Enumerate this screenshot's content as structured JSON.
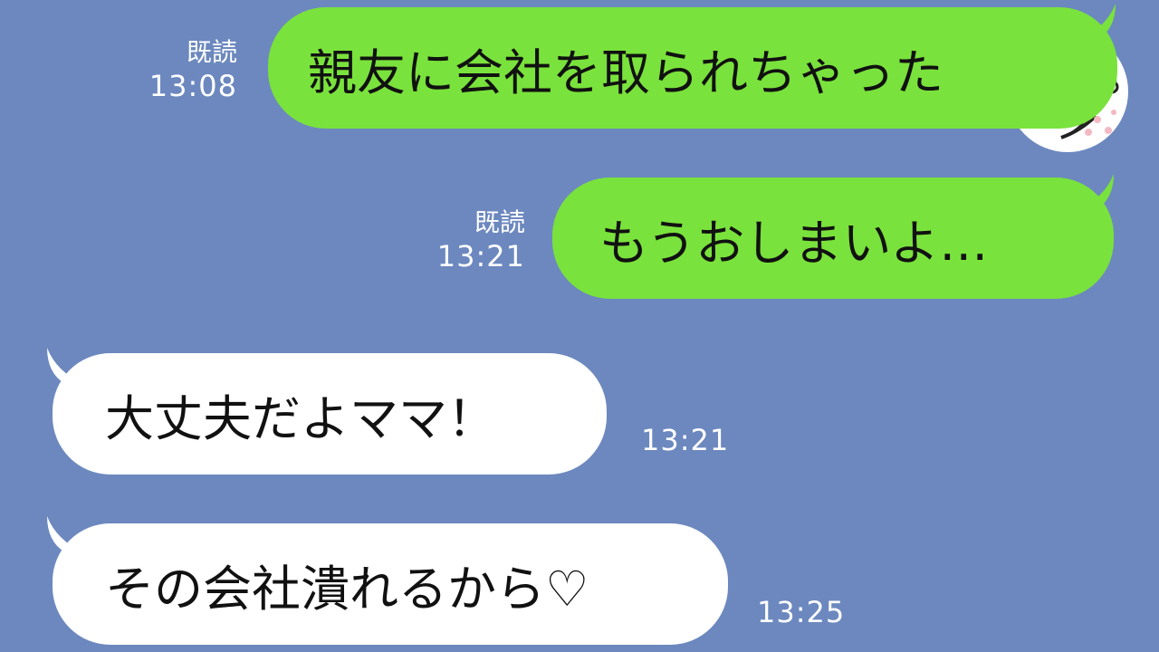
{
  "messages": [
    {
      "direction": "sent",
      "text": "親友に会社を取られちゃった",
      "read_label": "既読",
      "time": "13:08"
    },
    {
      "direction": "sent",
      "text": "もうおしまいよ…",
      "read_label": "既読",
      "time": "13:21"
    },
    {
      "direction": "received",
      "text": "大丈夫だよママ！",
      "time": "13:21"
    },
    {
      "direction": "received",
      "text": "その会社潰れるから♡",
      "time": "13:25"
    }
  ],
  "colors": {
    "background": "#6c88bf",
    "sent_bubble": "#7ae23c",
    "received_bubble": "#ffffff",
    "meta_text": "#ffffff"
  },
  "icons": {
    "avatar": "user-avatar-icon"
  }
}
